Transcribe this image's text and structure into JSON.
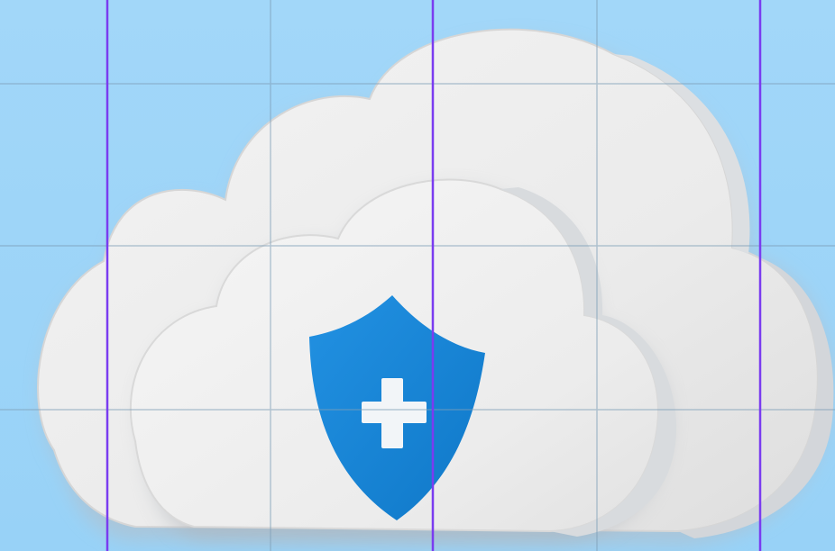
{
  "scene": {
    "subject": "cloud-with-shield-plus",
    "colors": {
      "background": "#9dd5f8",
      "grid_line": "#7fa9c8",
      "guide_line": "#7a3cf0",
      "cloud_face": "#f0f0f0",
      "cloud_shadow": "#c9cdd2",
      "shield": "#1a86d8",
      "plus": "#f2f5f8"
    },
    "icons": [
      "cloud-icon",
      "shield-icon",
      "plus-icon"
    ]
  }
}
